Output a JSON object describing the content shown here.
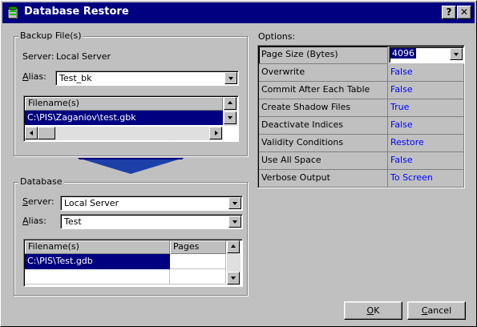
{
  "window": {
    "title": "Database Restore",
    "help_label": "?",
    "close_label": "✕"
  },
  "backup": {
    "group_label": "Backup File(s)",
    "server_label": "Server:",
    "server_value": "Local Server",
    "alias_label_u": "A",
    "alias_label_rest": "lias:",
    "alias_value": "Test_bk",
    "files_header": "Filename(s)",
    "files": [
      "C:\\PIS\\Zaganiov\\test.gbk"
    ]
  },
  "database": {
    "group_label": "Database",
    "server_label_u": "S",
    "server_label_rest": "erver:",
    "server_value": "Local Server",
    "alias_label_u": "A",
    "alias_label_rest": "lias:",
    "alias_value": "Test",
    "files_header": "Filename(s)",
    "pages_header": "Pages",
    "files": [
      {
        "name": "C:\\PIS\\Test.gdb",
        "pages": ""
      }
    ]
  },
  "options": {
    "label": "Options:",
    "rows": [
      {
        "name": "Page Size (Bytes)",
        "value": "4096"
      },
      {
        "name": "Overwrite",
        "value": "False"
      },
      {
        "name": "Commit After Each Table",
        "value": "False"
      },
      {
        "name": "Create Shadow Files",
        "value": "True"
      },
      {
        "name": "Deactivate Indices",
        "value": "False"
      },
      {
        "name": "Validity Conditions",
        "value": "Restore"
      },
      {
        "name": "Use All Space",
        "value": "False"
      },
      {
        "name": "Verbose Output",
        "value": "To Screen"
      }
    ]
  },
  "buttons": {
    "ok_u": "O",
    "ok_rest": "K",
    "cancel_u": "C",
    "cancel_rest": "ancel"
  },
  "colors": {
    "title_bg": "#000080",
    "selection": "#000080",
    "option_value": "#0000ff"
  },
  "icons": [
    "database-icon",
    "help-icon",
    "close-icon",
    "arrow-down-icon"
  ]
}
